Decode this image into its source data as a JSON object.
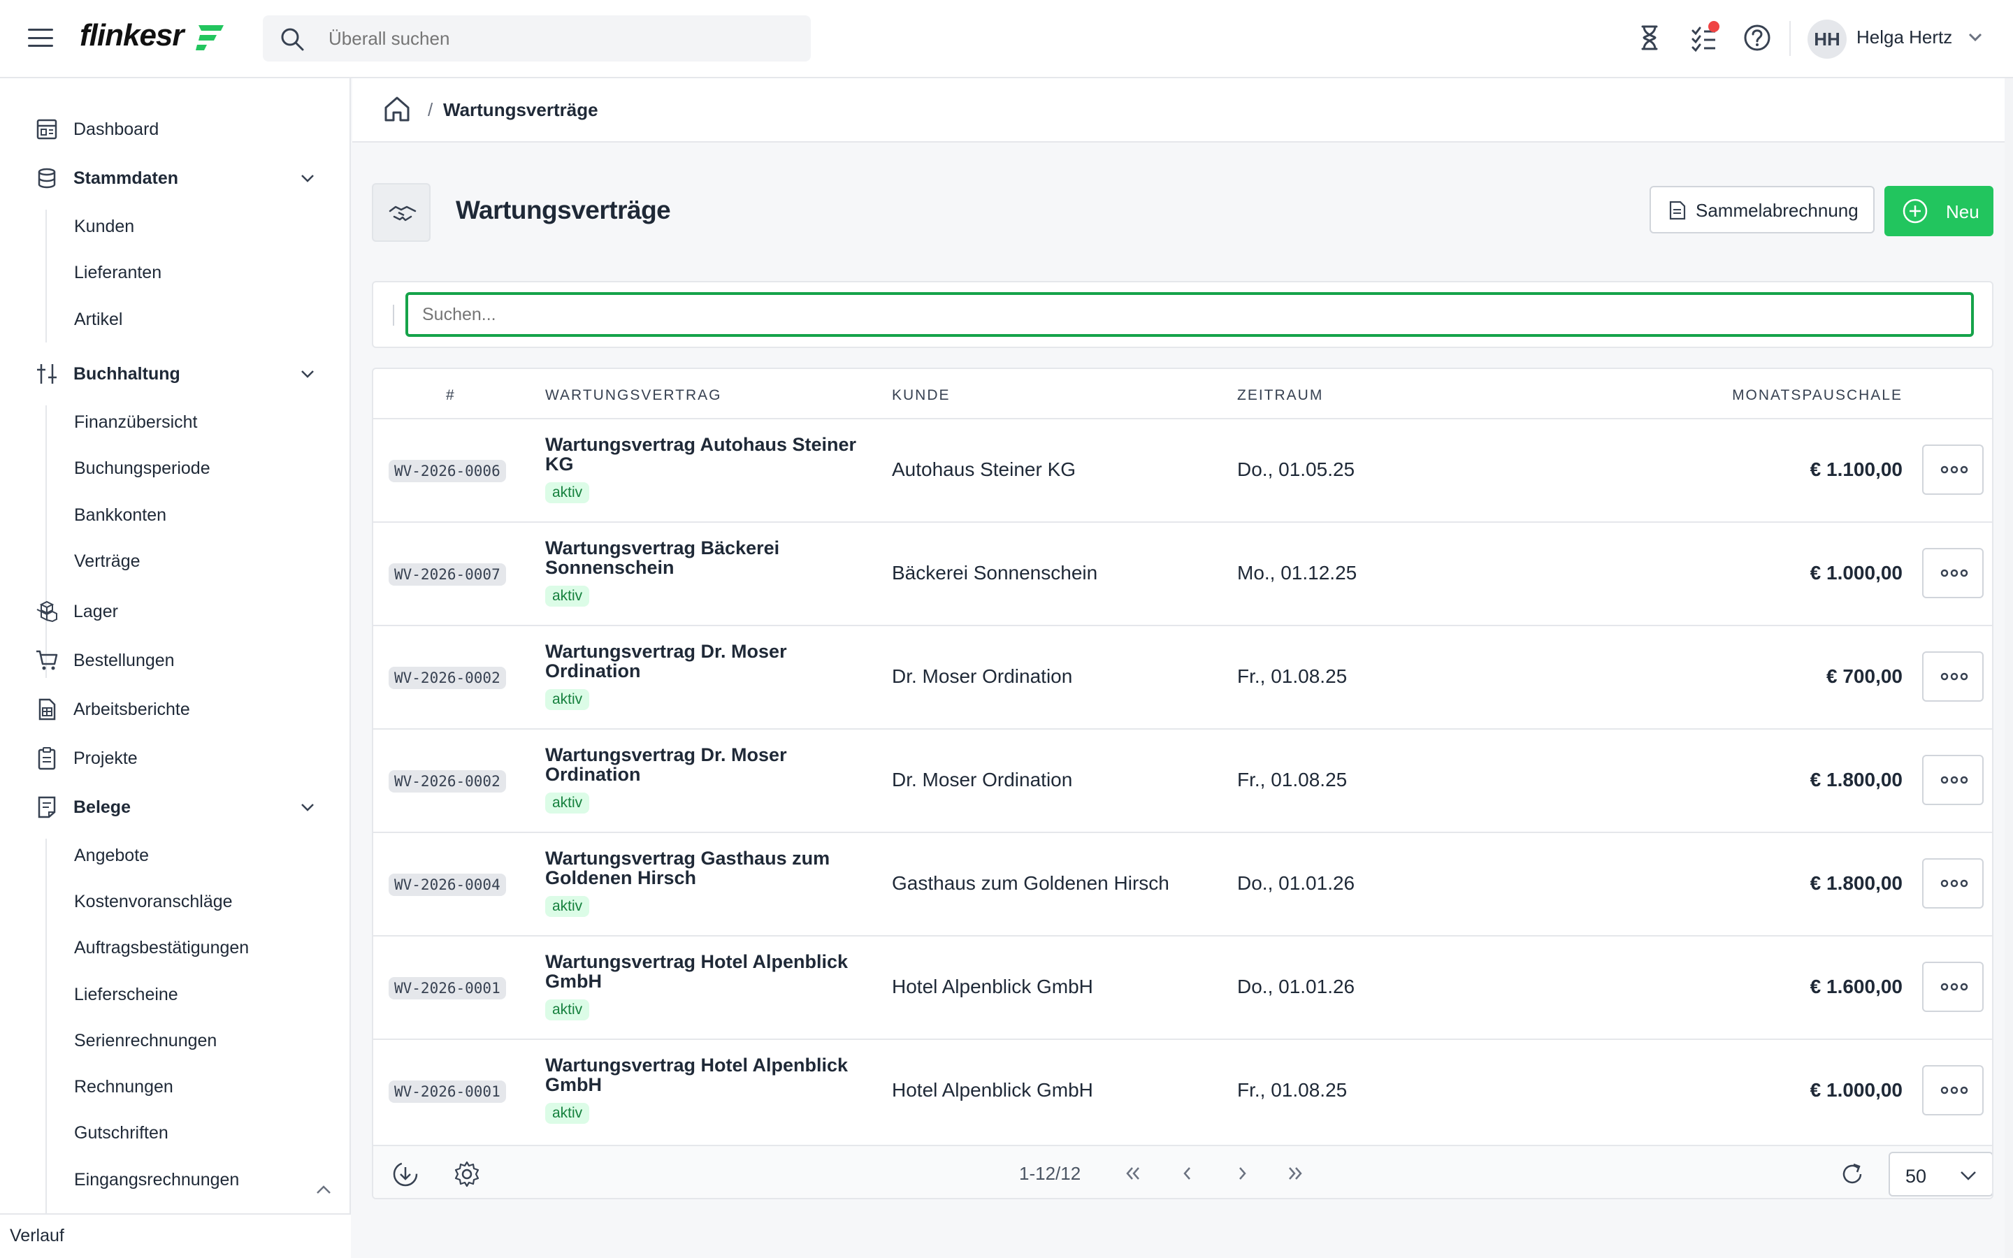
{
  "app": {
    "logo_text": "flinkesr",
    "brand_color": "#22c55e"
  },
  "topbar": {
    "search_placeholder": "Überall suchen",
    "user_initials": "HH",
    "user_name": "Helga Hertz"
  },
  "sidebar": {
    "items": [
      {
        "label": "Dashboard",
        "icon": "dashboard-icon"
      },
      {
        "label": "Stammdaten",
        "icon": "database-icon",
        "expanded": true
      },
      {
        "label": "Buchhaltung",
        "icon": "sliders-icon",
        "expanded": true
      },
      {
        "label": "Lager",
        "icon": "boxes-icon"
      },
      {
        "label": "Bestellungen",
        "icon": "cart-icon"
      },
      {
        "label": "Arbeitsberichte",
        "icon": "report-icon"
      },
      {
        "label": "Projekte",
        "icon": "clipboard-icon"
      },
      {
        "label": "Belege",
        "icon": "receipt-icon",
        "expanded": true
      }
    ],
    "stammdaten_sub": [
      "Kunden",
      "Lieferanten",
      "Artikel"
    ],
    "buchhaltung_sub": [
      "Finanzübersicht",
      "Buchungsperiode",
      "Bankkonten",
      "Verträge"
    ],
    "belege_sub": [
      "Angebote",
      "Kostenvoranschläge",
      "Auftragsbestätigungen",
      "Lieferscheine",
      "Serienrechnungen",
      "Rechnungen",
      "Gutschriften",
      "Eingangsrechnungen"
    ],
    "footer_label": "Verlauf"
  },
  "breadcrumb": {
    "current": "Wartungsverträge",
    "separator": "/"
  },
  "page": {
    "title": "Wartungsverträge",
    "sammel_label": "Sammelabrechnung",
    "new_label": "Neu",
    "search_placeholder": "Suchen..."
  },
  "table": {
    "headers": {
      "num": "#",
      "contract": "WARTUNGSVERTRAG",
      "customer": "KUNDE",
      "period": "ZEITRAUM",
      "monthly": "MONATSPAUSCHALE"
    },
    "rows": [
      {
        "id": "WV-2026-0006",
        "contract": "Wartungsvertrag Autohaus Steiner KG",
        "status": "aktiv",
        "customer": "Autohaus Steiner KG",
        "period": "Do., 01.05.25",
        "amount": "€ 1.100,00"
      },
      {
        "id": "WV-2026-0007",
        "contract": "Wartungsvertrag Bäckerei Sonnenschein",
        "status": "aktiv",
        "customer": "Bäckerei Sonnenschein",
        "period": "Mo., 01.12.25",
        "amount": "€ 1.000,00"
      },
      {
        "id": "WV-2026-0002",
        "contract": "Wartungsvertrag Dr. Moser Ordination",
        "status": "aktiv",
        "customer": "Dr. Moser Ordination",
        "period": "Fr., 01.08.25",
        "amount": "€ 700,00"
      },
      {
        "id": "WV-2026-0002",
        "contract": "Wartungsvertrag Dr. Moser Ordination",
        "status": "aktiv",
        "customer": "Dr. Moser Ordination",
        "period": "Fr., 01.08.25",
        "amount": "€ 1.800,00"
      },
      {
        "id": "WV-2026-0004",
        "contract": "Wartungsvertrag Gasthaus zum Goldenen Hirsch",
        "status": "aktiv",
        "customer": "Gasthaus zum Goldenen Hirsch",
        "period": "Do., 01.01.26",
        "amount": "€ 1.800,00"
      },
      {
        "id": "WV-2026-0001",
        "contract": "Wartungsvertrag Hotel Alpenblick GmbH",
        "status": "aktiv",
        "customer": "Hotel Alpenblick GmbH",
        "period": "Do., 01.01.26",
        "amount": "€ 1.600,00"
      },
      {
        "id": "WV-2026-0001",
        "contract": "Wartungsvertrag Hotel Alpenblick GmbH",
        "status": "aktiv",
        "customer": "Hotel Alpenblick GmbH",
        "period": "Fr., 01.08.25",
        "amount": "€ 1.000,00"
      }
    ],
    "pager": "1-12/12",
    "per_page": "50"
  }
}
